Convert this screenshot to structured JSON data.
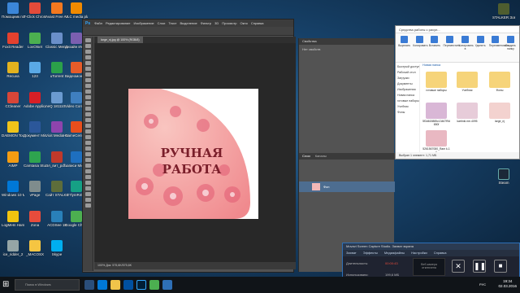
{
  "desktop": {
    "icons": [
      {
        "label": "Помощник по обновл...",
        "color": "#3b86d8"
      },
      {
        "label": "T-Click Chrome",
        "color": "#e34b3a"
      },
      {
        "label": "Avast Free Antivirus",
        "color": "#f2781f"
      },
      {
        "label": "VLC media player",
        "color": "#f08a00"
      },
      {
        "label": "Foxit Reader",
        "color": "#e4412e"
      },
      {
        "label": "LovOtset",
        "color": "#4caf50"
      },
      {
        "label": "Classic Menu Manager",
        "color": "#6a8fc9"
      },
      {
        "label": "Дизайн Интерьер...",
        "color": "#7b5fb0"
      },
      {
        "label": "Recuva",
        "color": "#e3b21e"
      },
      {
        "label": "123",
        "color": "#5aa9e6"
      },
      {
        "label": "uTorrent",
        "color": "#2ba14a"
      },
      {
        "label": "Видеомонтаж",
        "color": "#e65c2a"
      },
      {
        "label": "CCleaner",
        "color": "#d84638"
      },
      {
        "label": "Adobe Applicati...",
        "color": "#d81f26"
      },
      {
        "label": "neQ 181110...",
        "color": "#6b9bd1"
      },
      {
        "label": "Video Comm...",
        "color": "#3f7fbf"
      },
      {
        "label": "DAEMON Tools Lite",
        "color": "#f0c419"
      },
      {
        "label": "Документ Microsoft...",
        "color": "#2b579a"
      },
      {
        "label": "Vioit MediaHum...",
        "color": "#8e44ad"
      },
      {
        "label": "GameCenter My.Com",
        "color": "#e84e1c"
      },
      {
        "label": "AIMP",
        "color": "#f39c12"
      },
      {
        "label": "Camtasia Studio 8",
        "color": "#2ea44f"
      },
      {
        "label": "Эл_вит_pdf...",
        "color": "#c0392b"
      },
      {
        "label": "записи Microsoft",
        "color": "#1e6fbf"
      },
      {
        "label": "Windows 10 Manager",
        "color": "#0078d7"
      },
      {
        "label": "vPage",
        "color": "#7f8c8d"
      },
      {
        "label": "Сайт STALKER Зов Пр...",
        "color": "#5d6d3b"
      },
      {
        "label": "z7lynIR4fQ",
        "color": "#16a085"
      },
      {
        "label": "LogMeIn Hamachi",
        "color": "#f1c40f"
      },
      {
        "label": "Zona",
        "color": "#e74c3c"
      },
      {
        "label": "ACDSee 18",
        "color": "#2980b9"
      },
      {
        "label": "Google Chrome",
        "color": "#4caf50"
      },
      {
        "label": "ice_ridder_2",
        "color": "#95a5a6"
      },
      {
        "label": "_MACOSX",
        "color": "#f5c542"
      },
      {
        "label": "Skype",
        "color": "#00aff0"
      },
      {
        "label": "Steam",
        "color": "#1b2838"
      },
      {
        "label": "STALKER Зов Припяти",
        "color": "#4e5d2f"
      }
    ]
  },
  "photoshop": {
    "logo": "Ps",
    "menus": [
      "Файл",
      "Редактирование",
      "Изображение",
      "Слои",
      "Текст",
      "Выделение",
      "Фильтр",
      "3D",
      "Просмотр",
      "Окно",
      "Справка"
    ],
    "doc_tab": "large_nj.jpg @ 100% (RGB/8)",
    "artwork_text_line1": "РУЧНАЯ",
    "artwork_text_line2": "РАБОТА",
    "status": "100%   Док: 575,6K/575,6K",
    "panel_properties": "Свойства",
    "panel_properties_sub": "Нет свойств",
    "panel_layers": "Слои",
    "panel_channels": "Каналы",
    "layer_name": "Фон"
  },
  "explorer": {
    "title": "Средства работы с рисун...",
    "ribbon": [
      "Вырезать",
      "Копировать",
      "Вставить",
      "Переместить",
      "Копировать в",
      "Удалить",
      "Переименовать",
      "Создать папку",
      "Свойства",
      "Открыть",
      "Выделить"
    ],
    "nav": [
      "Быстрый доступ",
      "Рабочий стол",
      "Загрузки",
      "Документы",
      "Изображения",
      "Новая папка",
      "готовые наборы",
      "Учебник",
      "Фоны"
    ],
    "section": "Новая папка",
    "files": [
      {
        "name": "готовые наборы",
        "color": "#f6d47a"
      },
      {
        "name": "Учебник",
        "color": "#f6d47a"
      },
      {
        "name": "Фоны",
        "color": "#f6d47a"
      },
      {
        "name": "5f3d615885c13467f9d650f",
        "color": "#d9b7d6"
      },
      {
        "name": "kartinki.me-4095",
        "color": "#e7ccd9"
      },
      {
        "name": "large_nj",
        "color": "#f3d2cf"
      },
      {
        "name": "5261567080_Ram k-1f",
        "color": "#e9b8c2"
      }
    ],
    "status": "Выбран 1 элемент: 1,71 МБ"
  },
  "movavi": {
    "title": "Movavi Screen Capture Studio. Захват экрана",
    "menus": [
      "Захват",
      "Эффекты",
      "Медиафайлы",
      "Настройки",
      "Справка"
    ],
    "duration_label": "Длительность:",
    "duration_value": "00:00:43",
    "used_label": "Использовано:",
    "used_value": "199,6 МБ",
    "free_label": "Свободно:",
    "free_value": "4,3 ГБ",
    "webcam": "Веб-камера отключена",
    "cancel": "Отмена",
    "pause": "Пауза",
    "stop": "Стоп"
  },
  "taskbar": {
    "search_placeholder": "Поиск в Windows",
    "time": "19:34",
    "date": "02.03.2016",
    "lang": "РУС"
  }
}
